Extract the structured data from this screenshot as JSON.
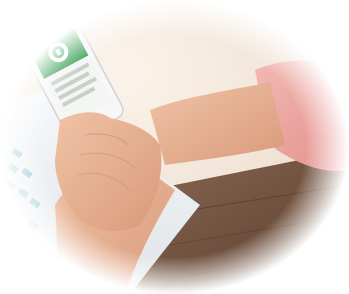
{
  "scene": {
    "subject": "hands-holding-smartphone",
    "phone": {
      "header_color": "#2e9a4a",
      "screen_color": "#f4f6f4",
      "icon": "app-logo-icon"
    },
    "colors": {
      "skin": "#e7b294",
      "shirt": "#e8a5a0",
      "desk": "#6a4a38",
      "laptop": "#eef1f3",
      "keys": "#8fc6d8",
      "background": "#f2e7dc"
    }
  }
}
